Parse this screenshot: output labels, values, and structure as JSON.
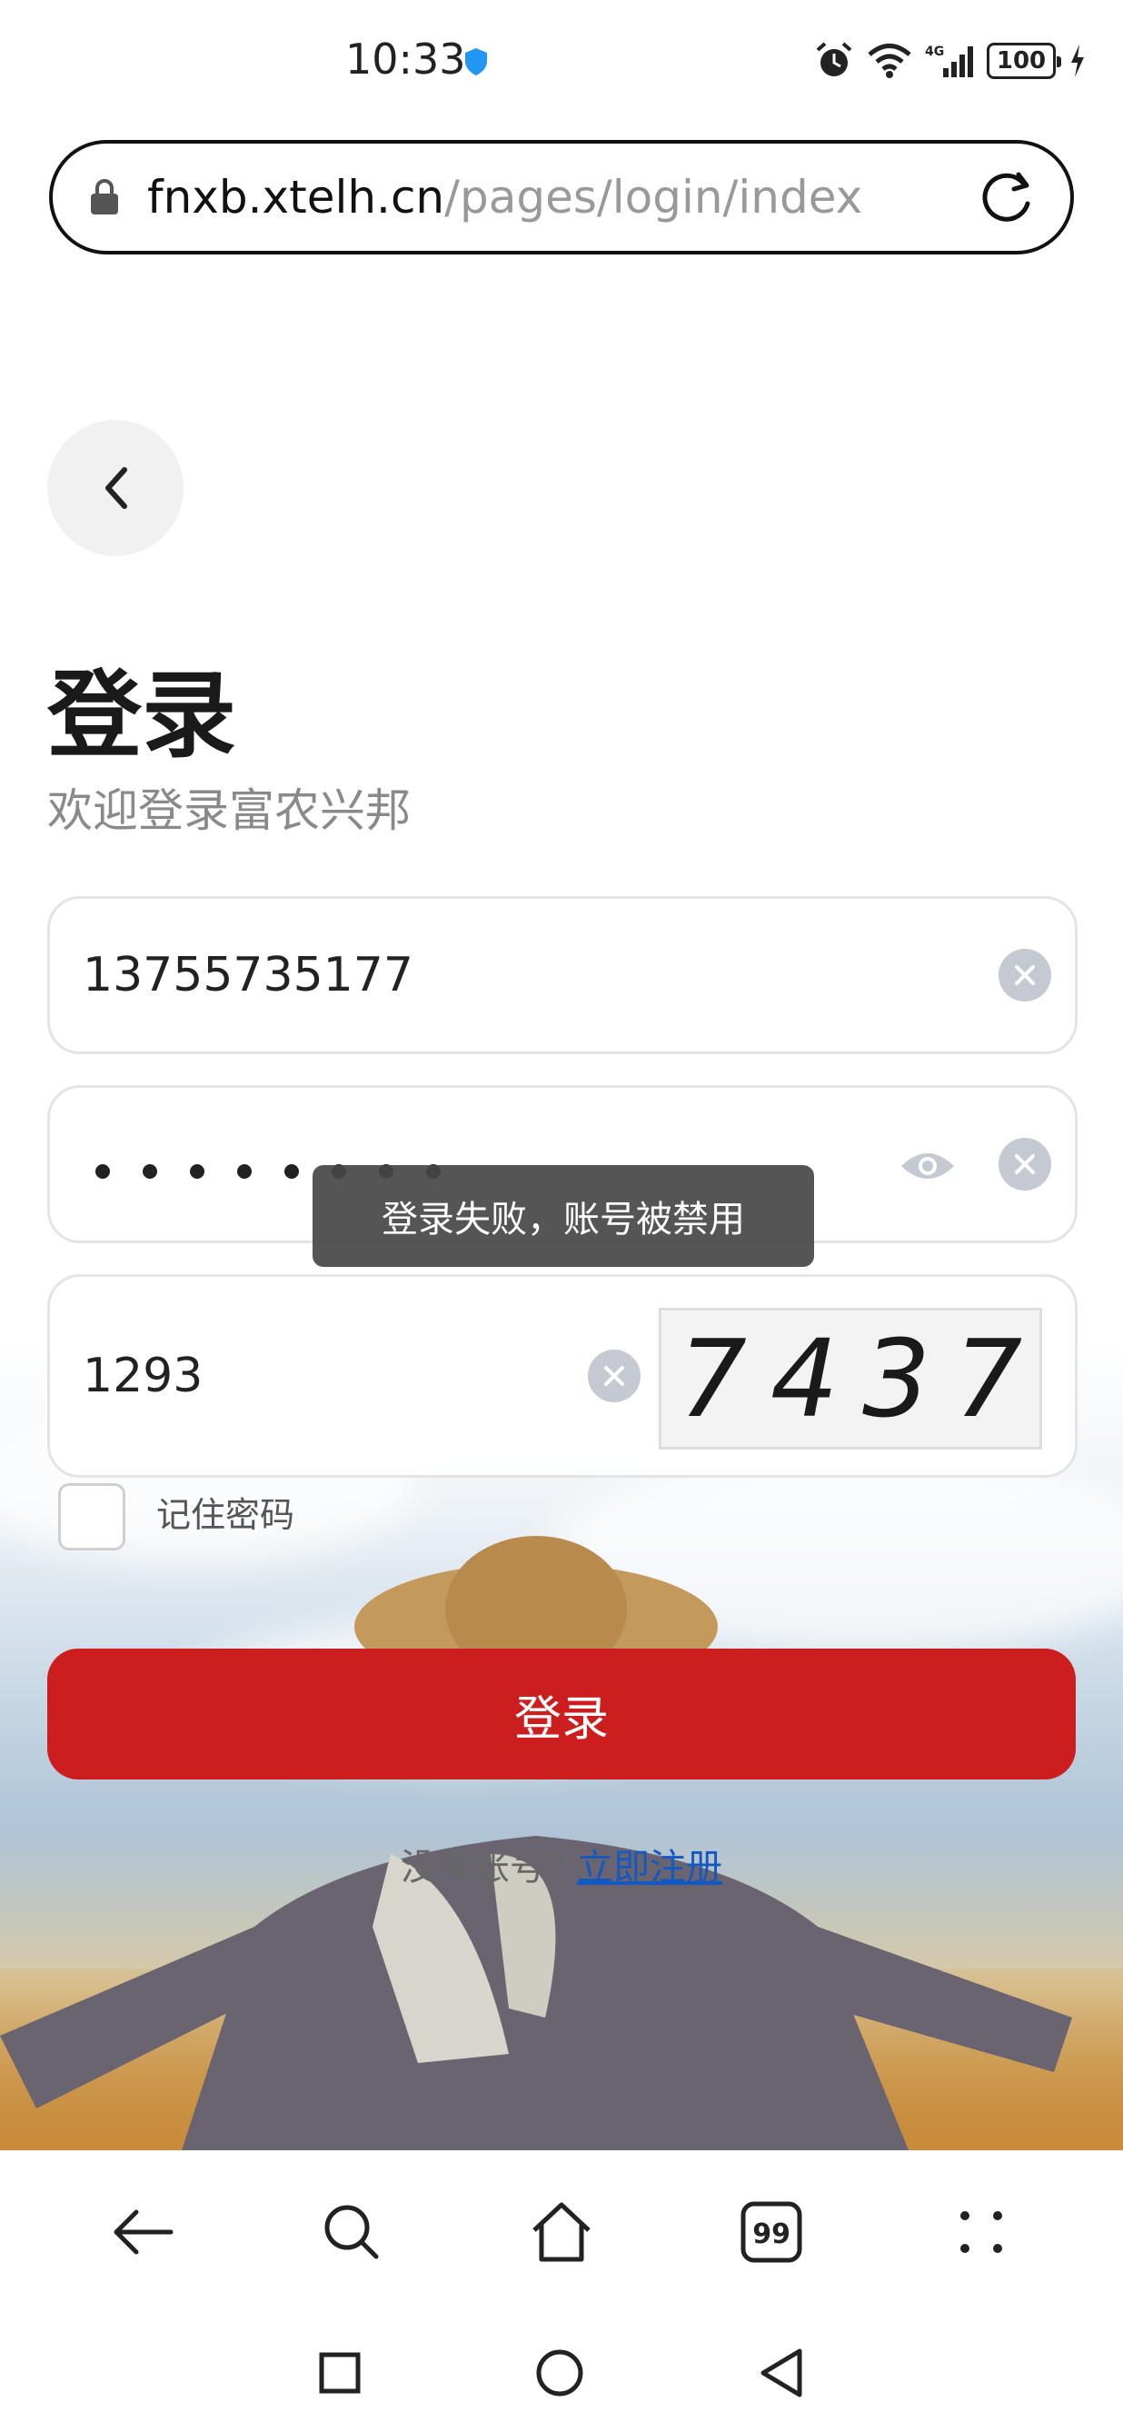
{
  "status_bar": {
    "time": "10:33",
    "battery": "100"
  },
  "browser": {
    "url_host": "fnxb.xtelh.cn",
    "url_path": "/pages/login/index"
  },
  "login": {
    "title": "登录",
    "subtitle": "欢迎登录富农兴邦",
    "phone_value": "13755735177",
    "password_dots": 8,
    "captcha_input_value": "1293",
    "captcha_image_text": "7437",
    "remember_label": "记住密码",
    "submit_label": "登录",
    "register_question": "没有账号?",
    "register_link": "立即注册"
  },
  "toast": {
    "message": "登录失败，账号被禁用"
  },
  "bottom_bar": {
    "tabs_count": "99"
  },
  "colors": {
    "accent": "#cc1e1e",
    "link": "#1558c0"
  }
}
